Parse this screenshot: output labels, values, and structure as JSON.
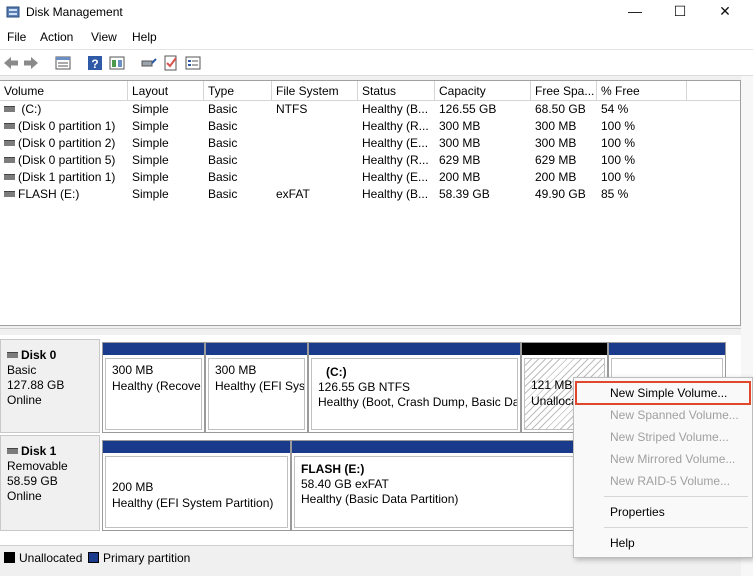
{
  "window": {
    "title": "Disk Management",
    "controls": {
      "minimize": "—",
      "maximize": "☐",
      "close": "✕"
    }
  },
  "menu": [
    "File",
    "Action",
    "View",
    "Help"
  ],
  "toolbar": {
    "icons": [
      "back-icon",
      "forward-icon",
      "disk-list-icon",
      "help-icon",
      "console-icon",
      "connect-icon",
      "check-icon",
      "properties-icon"
    ]
  },
  "volume_list": {
    "columns": [
      "Volume",
      "Layout",
      "Type",
      "File System",
      "Status",
      "Capacity",
      "Free Spa...",
      "% Free"
    ],
    "rows": [
      {
        "volume": " (C:)",
        "layout": "Simple",
        "type": "Basic",
        "fs": "NTFS",
        "status": "Healthy (B...",
        "capacity": "126.55 GB",
        "free": "68.50 GB",
        "pct": "54 %"
      },
      {
        "volume": "(Disk 0 partition 1)",
        "layout": "Simple",
        "type": "Basic",
        "fs": "",
        "status": "Healthy (R...",
        "capacity": "300 MB",
        "free": "300 MB",
        "pct": "100 %"
      },
      {
        "volume": "(Disk 0 partition 2)",
        "layout": "Simple",
        "type": "Basic",
        "fs": "",
        "status": "Healthy (E...",
        "capacity": "300 MB",
        "free": "300 MB",
        "pct": "100 %"
      },
      {
        "volume": "(Disk 0 partition 5)",
        "layout": "Simple",
        "type": "Basic",
        "fs": "",
        "status": "Healthy (R...",
        "capacity": "629 MB",
        "free": "629 MB",
        "pct": "100 %"
      },
      {
        "volume": "(Disk 1 partition 1)",
        "layout": "Simple",
        "type": "Basic",
        "fs": "",
        "status": "Healthy (E...",
        "capacity": "200 MB",
        "free": "200 MB",
        "pct": "100 %"
      },
      {
        "volume": "FLASH (E:)",
        "layout": "Simple",
        "type": "Basic",
        "fs": "exFAT",
        "status": "Healthy (B...",
        "capacity": "58.39 GB",
        "free": "49.90 GB",
        "pct": "85 %"
      }
    ]
  },
  "disks": [
    {
      "name": "Disk 0",
      "kind": "Basic",
      "size": "127.88 GB",
      "state": "Online",
      "partitions": [
        {
          "title": "",
          "line1": "300 MB",
          "line2": "Healthy (Recove",
          "unallocated": false
        },
        {
          "title": "",
          "line1": "300 MB",
          "line2": "Healthy (EFI Syst",
          "unallocated": false
        },
        {
          "title": "(C:)",
          "line1": "126.55 GB NTFS",
          "line2": "Healthy (Boot, Crash Dump, Basic Dat",
          "unallocated": false
        },
        {
          "title": "",
          "line1": "121 MB",
          "line2": "Unalloca",
          "unallocated": true
        },
        {
          "title": "",
          "line1": "",
          "line2": "",
          "unallocated": false
        }
      ]
    },
    {
      "name": "Disk 1",
      "kind": "Removable",
      "size": "58.59 GB",
      "state": "Online",
      "partitions": [
        {
          "title": "",
          "line1": "200 MB",
          "line2": "Healthy (EFI System Partition)",
          "unallocated": false
        },
        {
          "title": "FLASH  (E:)",
          "line1": "58.40 GB exFAT",
          "line2": "Healthy (Basic Data Partition)",
          "unallocated": false
        }
      ]
    }
  ],
  "legend": [
    {
      "label": "Unallocated",
      "color": "#000000"
    },
    {
      "label": "Primary partition",
      "color": "#1a3b8c"
    }
  ],
  "context_menu": {
    "items": [
      {
        "label": "New Simple Volume...",
        "enabled": true
      },
      {
        "label": "New Spanned Volume...",
        "enabled": false
      },
      {
        "label": "New Striped Volume...",
        "enabled": false
      },
      {
        "label": "New Mirrored Volume...",
        "enabled": false
      },
      {
        "label": "New RAID-5 Volume...",
        "enabled": false
      },
      {
        "label": "Properties",
        "enabled": true
      },
      {
        "label": "Help",
        "enabled": true
      }
    ]
  },
  "colors": {
    "primary_partition": "#1a3b8c",
    "unallocated": "#000000",
    "highlight": "#e0472b"
  }
}
